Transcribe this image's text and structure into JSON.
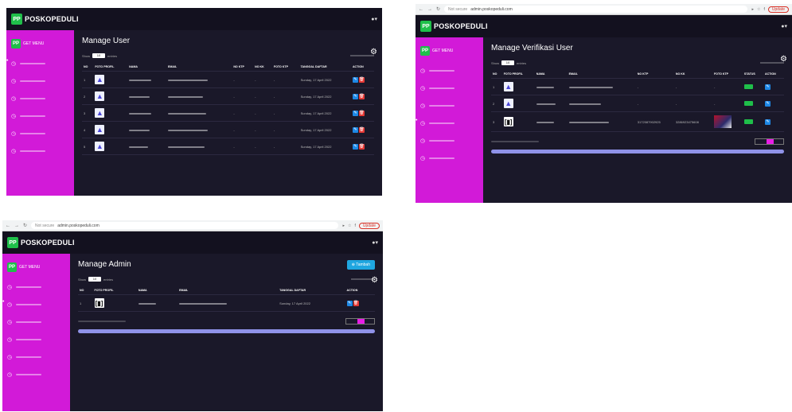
{
  "brand": {
    "logo_text": "PP",
    "name": "POSKOPEDULI"
  },
  "sidebar": {
    "header": "GET MENU"
  },
  "screens": {
    "users": {
      "title": "Manage User",
      "show": "Show",
      "entries": "entries",
      "page_size": "10",
      "headers": [
        "NO",
        "FOTO PROFIL",
        "NAMA",
        "EMAIL",
        "NO KTP",
        "NO KK",
        "FOTO KTP",
        "TANGGAL DAFTAR",
        "ACTION"
      ],
      "rows": [
        {
          "no": "1",
          "date": "Sunday, 17 April 2022"
        },
        {
          "no": "2",
          "date": "Sunday, 17 April 2022"
        },
        {
          "no": "3",
          "date": "Sunday, 17 April 2022"
        },
        {
          "no": "4",
          "date": "Sunday, 17 April 2022"
        },
        {
          "no": "5",
          "date": "Sunday, 17 April 2022"
        }
      ]
    },
    "verif": {
      "title": "Manage Verifikasi User",
      "url": "admin.poskopeduli.com",
      "not_secure": "Not secure",
      "headers": [
        "NO",
        "FOTO PROFIL",
        "NAMA",
        "EMAIL",
        "NO KTP",
        "NO KK",
        "FOTO KTP",
        "STATUS",
        "ACTION"
      ],
      "rows": [
        {
          "no": "1"
        },
        {
          "no": "2"
        },
        {
          "no": "3",
          "ktp": "3172087902925",
          "kk": "3286923475608"
        }
      ],
      "update": "Update"
    },
    "admin": {
      "title": "Manage Admin",
      "url": "admin.poskopeduli.com",
      "not_secure": "Not secure",
      "add_button": "Tambah",
      "headers": [
        "NO",
        "FOTO PROFIL",
        "NAMA",
        "EMAIL",
        "TANGGAL DAFTAR",
        "ACTION"
      ],
      "rows": [
        {
          "no": "1",
          "date": "Sunday, 17 April 2022"
        }
      ],
      "update": "Update"
    }
  },
  "colors": {
    "sidebar": "#d21ad8",
    "bg": "#1a1829",
    "accent": "#1e88e5",
    "danger": "#e53935",
    "success": "#1fbf4a"
  }
}
